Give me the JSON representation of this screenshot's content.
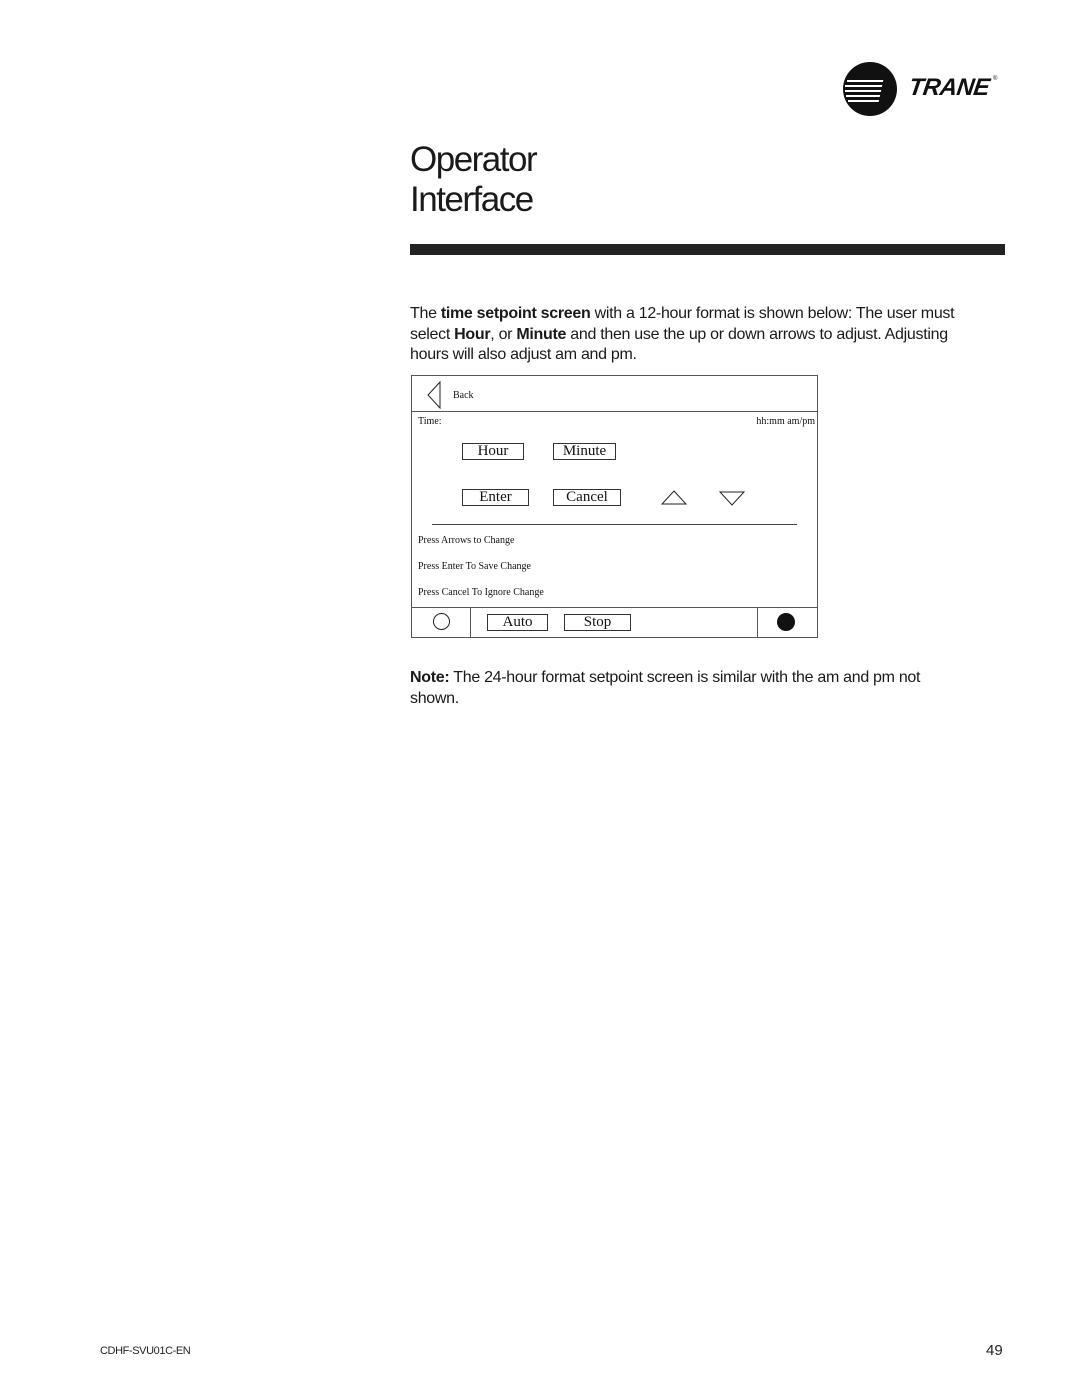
{
  "brand": {
    "name": "TRANE",
    "registered_mark": "®"
  },
  "heading": {
    "line1": "Operator",
    "line2": "Interface"
  },
  "intro": {
    "t1": "The ",
    "b1": "time setpoint screen",
    "t2": " with a 12-hour format is shown below: The user must select  ",
    "b2": "Hour",
    "t3": ", or ",
    "b3": "Minute",
    "t4": " and then use the up or down arrows to adjust. Adjusting hours will also adjust am and pm."
  },
  "screen": {
    "back_label": "Back",
    "time_label": "Time:",
    "format_label": "hh:mm am/pm",
    "hour_button": "Hour",
    "minute_button": "Minute",
    "enter_button": "Enter",
    "cancel_button": "Cancel",
    "instructions": [
      "Press Arrows to Change",
      "Press Enter To Save Change",
      "Press Cancel To Ignore Change"
    ],
    "auto_button": "Auto",
    "stop_button": "Stop"
  },
  "note": {
    "label": "Note:",
    "text": " The 24-hour format setpoint screen is similar with the am and pm not shown."
  },
  "footer": {
    "doc_id": "CDHF-SVU01C-EN",
    "page_number": "49"
  }
}
